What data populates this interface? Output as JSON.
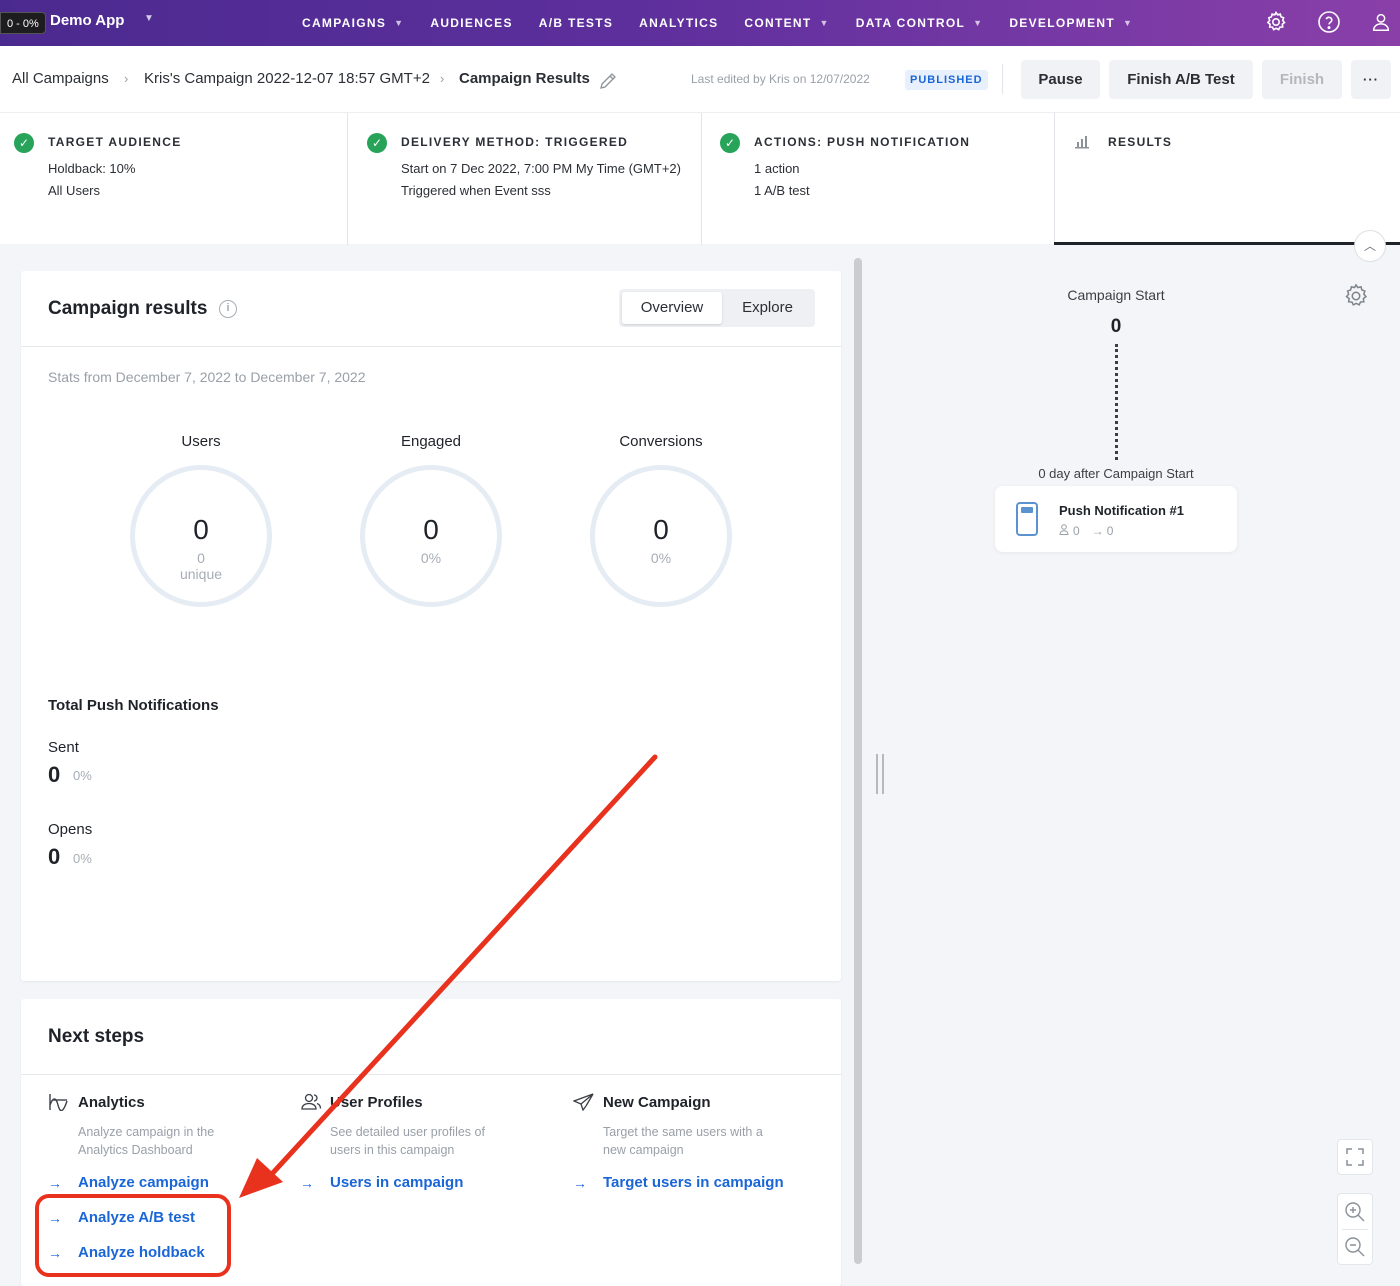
{
  "topnav": {
    "percent_badge": "0 - 0%",
    "app_name": "Demo App",
    "links": [
      {
        "label": "CAMPAIGNS",
        "has_caret": true
      },
      {
        "label": "AUDIENCES",
        "has_caret": false
      },
      {
        "label": "A/B TESTS",
        "has_caret": false
      },
      {
        "label": "ANALYTICS",
        "has_caret": false
      },
      {
        "label": "CONTENT",
        "has_caret": true
      },
      {
        "label": "DATA CONTROL",
        "has_caret": true
      },
      {
        "label": "DEVELOPMENT",
        "has_caret": true
      }
    ],
    "icons": [
      "gear-icon",
      "help-icon",
      "user-icon"
    ]
  },
  "breadcrumb": {
    "root": "All Campaigns",
    "campaign": "Kris's Campaign 2022-12-07 18:57 GMT+2",
    "current": "Campaign Results",
    "last_edited": "Last edited by Kris on 12/07/2022",
    "status": "PUBLISHED"
  },
  "actions": {
    "pause": "Pause",
    "finish_ab": "Finish A/B Test",
    "finish": "Finish",
    "more": "···"
  },
  "summary": {
    "audience": {
      "title": "TARGET AUDIENCE",
      "lines": [
        "Holdback: 10%",
        "All Users"
      ]
    },
    "delivery": {
      "title": "DELIVERY METHOD: TRIGGERED",
      "lines": [
        "Start on 7 Dec 2022, 7:00 PM My Time (GMT+2)",
        "Triggered when Event sss"
      ]
    },
    "actions": {
      "title": "ACTIONS: PUSH NOTIFICATION",
      "lines": [
        "1 action",
        "1 A/B test"
      ]
    },
    "results": {
      "title": "RESULTS"
    }
  },
  "results_card": {
    "title": "Campaign results",
    "tabs": [
      "Overview",
      "Explore"
    ],
    "active_tab": "Overview",
    "stats_from": "Stats from December 7, 2022 to December 7, 2022",
    "metrics": [
      {
        "label": "Users",
        "value": "0",
        "sub1": "0",
        "sub2": "unique"
      },
      {
        "label": "Engaged",
        "value": "0",
        "sub1": "0%"
      },
      {
        "label": "Conversions",
        "value": "0",
        "sub1": "0%"
      }
    ],
    "push": {
      "title": "Total Push Notifications",
      "sent": {
        "label": "Sent",
        "value": "0",
        "pct": "0%"
      },
      "opens": {
        "label": "Opens",
        "value": "0",
        "pct": "0%"
      }
    }
  },
  "next_steps": {
    "title": "Next steps",
    "analytics": {
      "title": "Analytics",
      "desc": "Analyze campaign in the Analytics Dashboard",
      "links": [
        "Analyze campaign",
        "Analyze A/B test",
        "Analyze holdback"
      ]
    },
    "profiles": {
      "title": "User Profiles",
      "desc": "See detailed user profiles of users in this campaign",
      "link": "Users in campaign"
    },
    "new_campaign": {
      "title": "New Campaign",
      "desc": "Target the same users with a new campaign",
      "link": "Target users in campaign"
    }
  },
  "flow": {
    "start_label": "Campaign Start",
    "start_count": "0",
    "delay_label": "0 day after Campaign Start",
    "node": {
      "title": "Push Notification #1",
      "users": "0",
      "sends": "0"
    }
  },
  "colors": {
    "accent": "#1a66d6",
    "nav_start": "#4b2a8f",
    "nav_end": "#8a3fa8",
    "success": "#27a35a",
    "annotation": "#e8321e"
  }
}
